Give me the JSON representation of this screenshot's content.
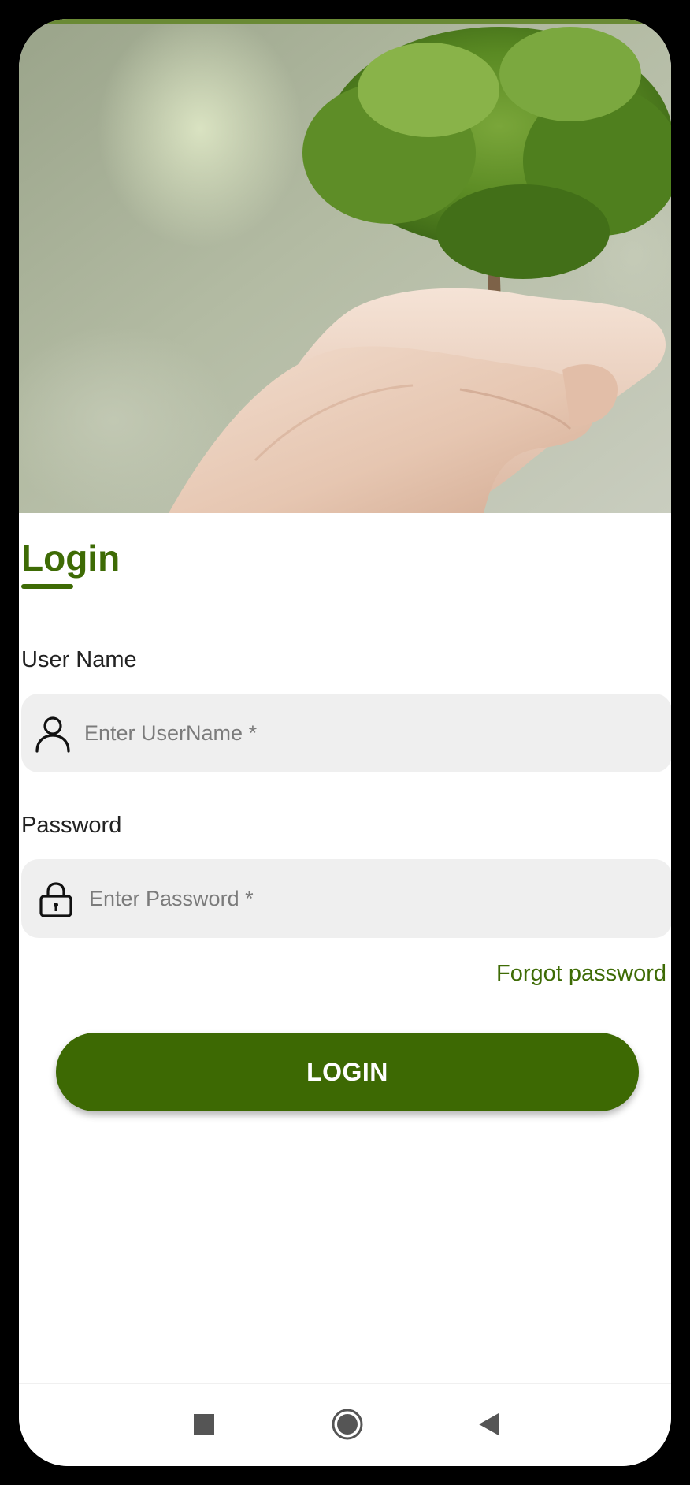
{
  "screen": {
    "title": "Login",
    "hero_image": "hands-holding-tree-image"
  },
  "form": {
    "username": {
      "label": "User Name",
      "placeholder": "Enter UserName *",
      "value": "",
      "icon": "user-icon"
    },
    "password": {
      "label": "Password",
      "placeholder": "Enter Password *",
      "value": "",
      "icon": "lock-icon"
    },
    "forgot_password": "Forgot password",
    "submit_label": "LOGIN"
  },
  "navigation_bar": {
    "buttons": [
      {
        "name": "recents",
        "icon": "square-icon"
      },
      {
        "name": "home",
        "icon": "circle-icon"
      },
      {
        "name": "back",
        "icon": "triangle-back-icon"
      }
    ]
  },
  "colors": {
    "accent": "#3e6b05",
    "field_background": "#efefef",
    "background": "#ffffff"
  }
}
